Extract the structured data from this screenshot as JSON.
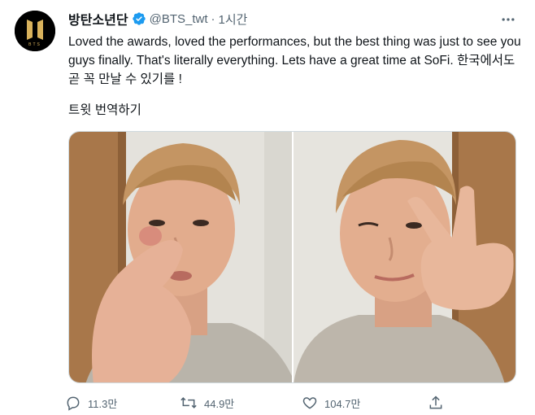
{
  "account": {
    "display_name": "방탄소년단",
    "handle": "@BTS_twt",
    "separator": "·",
    "time": "1시간",
    "avatar_text": "BTS"
  },
  "tweet": {
    "text": "Loved the awards, loved the performances, but the best thing was just to see you guys finally. That's literally everything. Lets have a great time at SoFi. 한국에서도 곧 꼭 만날 수 있기를 !",
    "translate_label": "트윗 번역하기"
  },
  "actions": {
    "reply_count": "11.3만",
    "retweet_count": "44.9만",
    "like_count": "104.7만"
  },
  "colors": {
    "verified": "#1d9bf0",
    "secondary_text": "#536471",
    "avatar_gold": "#d9b25c"
  },
  "icons": [
    "verified-badge-icon",
    "more-options-icon",
    "reply-icon",
    "retweet-icon",
    "like-icon",
    "share-icon"
  ]
}
